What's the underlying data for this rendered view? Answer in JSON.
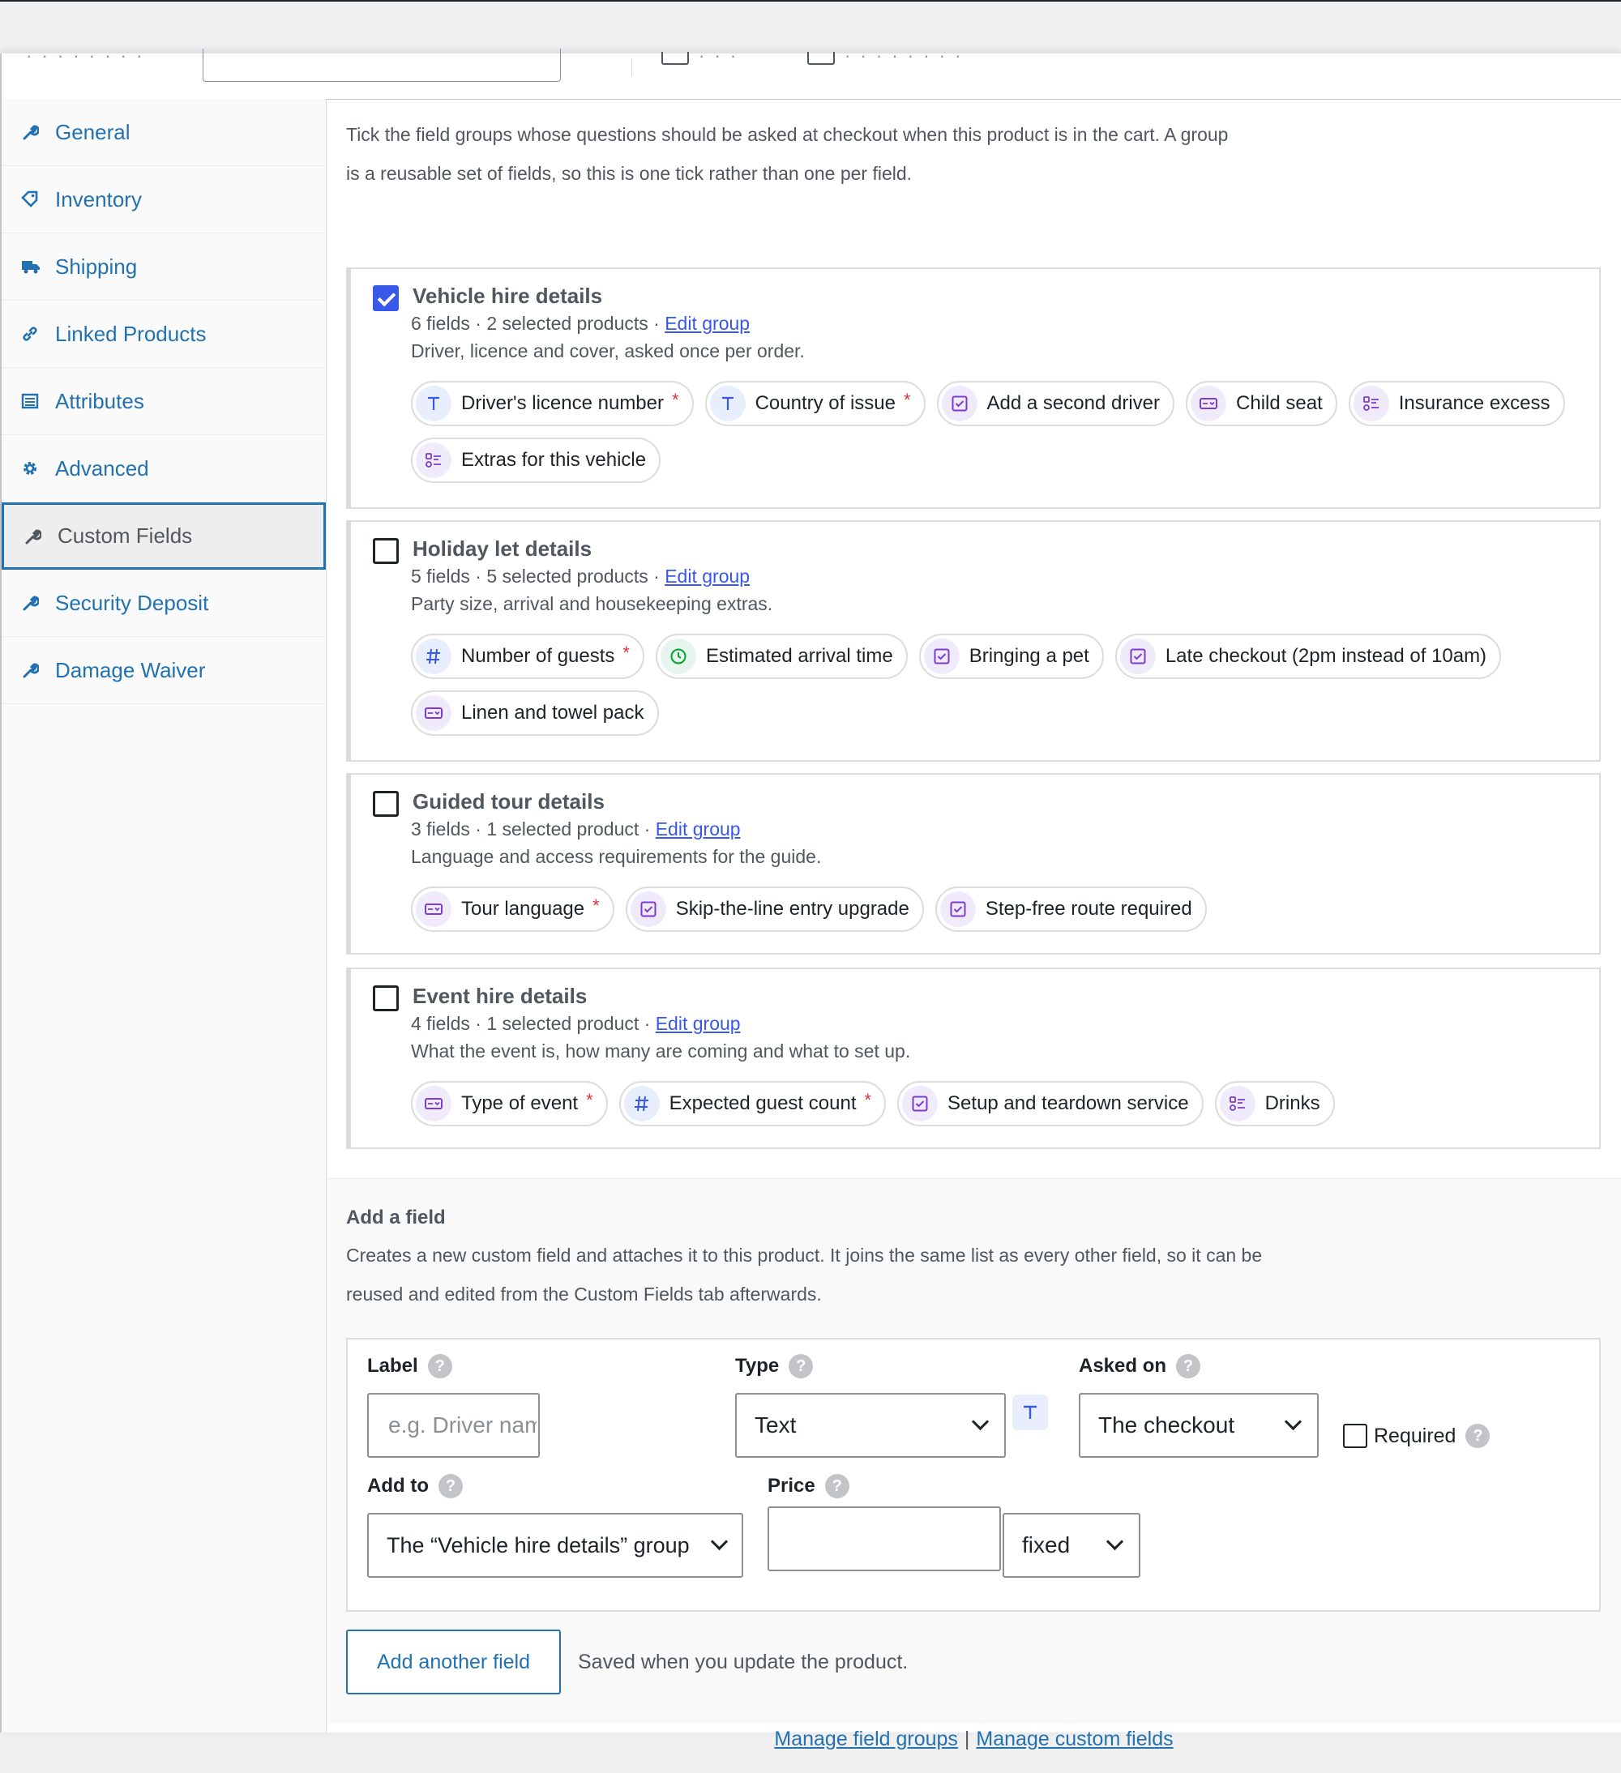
{
  "sidebar": {
    "tabs": [
      {
        "label": "General",
        "icon": "wrench-icon",
        "active": false
      },
      {
        "label": "Inventory",
        "icon": "tag-icon",
        "active": false
      },
      {
        "label": "Shipping",
        "icon": "truck-icon",
        "active": false
      },
      {
        "label": "Linked Products",
        "icon": "link-icon",
        "active": false
      },
      {
        "label": "Attributes",
        "icon": "list-table-icon",
        "active": false
      },
      {
        "label": "Advanced",
        "icon": "gear-icon",
        "active": false
      },
      {
        "label": "Custom Fields",
        "icon": "wrench-icon",
        "active": true
      },
      {
        "label": "Security Deposit",
        "icon": "wrench-icon",
        "active": false
      },
      {
        "label": "Damage Waiver",
        "icon": "wrench-icon",
        "active": false
      }
    ]
  },
  "intro": "Tick the field groups whose questions should be asked at checkout when this product is in the cart. A group is a reusable set of fields, so this is one tick rather than one per field.",
  "groups": [
    {
      "title": "Vehicle hire details",
      "checked": true,
      "meta": "6 fields · 2 selected products · ",
      "edit_label": "Edit group",
      "desc": "Driver, licence and cover, asked once per order.",
      "fields": [
        {
          "label": "Driver's licence number",
          "type": "text",
          "required": true
        },
        {
          "label": "Country of issue",
          "type": "text",
          "required": true
        },
        {
          "label": "Add a second driver",
          "type": "checkbox",
          "required": false
        },
        {
          "label": "Child seat",
          "type": "select",
          "required": false
        },
        {
          "label": "Insurance excess",
          "type": "multi",
          "required": false
        },
        {
          "label": "Extras for this vehicle",
          "type": "multi",
          "required": false
        }
      ]
    },
    {
      "title": "Holiday let details",
      "checked": false,
      "meta": "5 fields · 5 selected products · ",
      "edit_label": "Edit group",
      "desc": "Party size, arrival and housekeeping extras.",
      "fields": [
        {
          "label": "Number of guests",
          "type": "number",
          "required": true
        },
        {
          "label": "Estimated arrival time",
          "type": "time",
          "required": false
        },
        {
          "label": "Bringing a pet",
          "type": "checkbox",
          "required": false
        },
        {
          "label": "Late checkout (2pm instead of 10am)",
          "type": "checkbox",
          "required": false
        },
        {
          "label": "Linen and towel pack",
          "type": "select",
          "required": false
        }
      ]
    },
    {
      "title": "Guided tour details",
      "checked": false,
      "meta": "3 fields · 1 selected product · ",
      "edit_label": "Edit group",
      "desc": "Language and access requirements for the guide.",
      "fields": [
        {
          "label": "Tour language",
          "type": "select",
          "required": true
        },
        {
          "label": "Skip-the-line entry upgrade",
          "type": "checkbox",
          "required": false
        },
        {
          "label": "Step-free route required",
          "type": "checkbox",
          "required": false
        }
      ]
    },
    {
      "title": "Event hire details",
      "checked": false,
      "meta": "4 fields · 1 selected product · ",
      "edit_label": "Edit group",
      "desc": "What the event is, how many are coming and what to set up.",
      "fields": [
        {
          "label": "Type of event",
          "type": "select",
          "required": true
        },
        {
          "label": "Expected guest count",
          "type": "number",
          "required": true
        },
        {
          "label": "Setup and teardown service",
          "type": "checkbox",
          "required": false
        },
        {
          "label": "Drinks",
          "type": "multi",
          "required": false
        }
      ]
    }
  ],
  "add_field": {
    "title": "Add a field",
    "desc": "Creates a new custom field and attaches it to this product. It joins the same list as every other field, so it can be reused and edited from the Custom Fields tab afterwards.",
    "label_label": "Label",
    "label_placeholder": "e.g. Driver name",
    "type_label": "Type",
    "type_value": "Text",
    "asked_on_label": "Asked on",
    "asked_on_value": "The checkout",
    "required_label": "Required",
    "add_to_label": "Add to",
    "add_to_value": "The “Vehicle hire details” group",
    "price_label": "Price",
    "price_value": "",
    "price_mode": "fixed",
    "add_button": "Add another field",
    "saved_note": "Saved when you update the product."
  },
  "footer": {
    "manage_groups": "Manage field groups",
    "separator": "|",
    "manage_fields": "Manage custom fields"
  },
  "colors": {
    "link": "#2271b1",
    "accent": "#3858e9",
    "required": "#d63638"
  }
}
